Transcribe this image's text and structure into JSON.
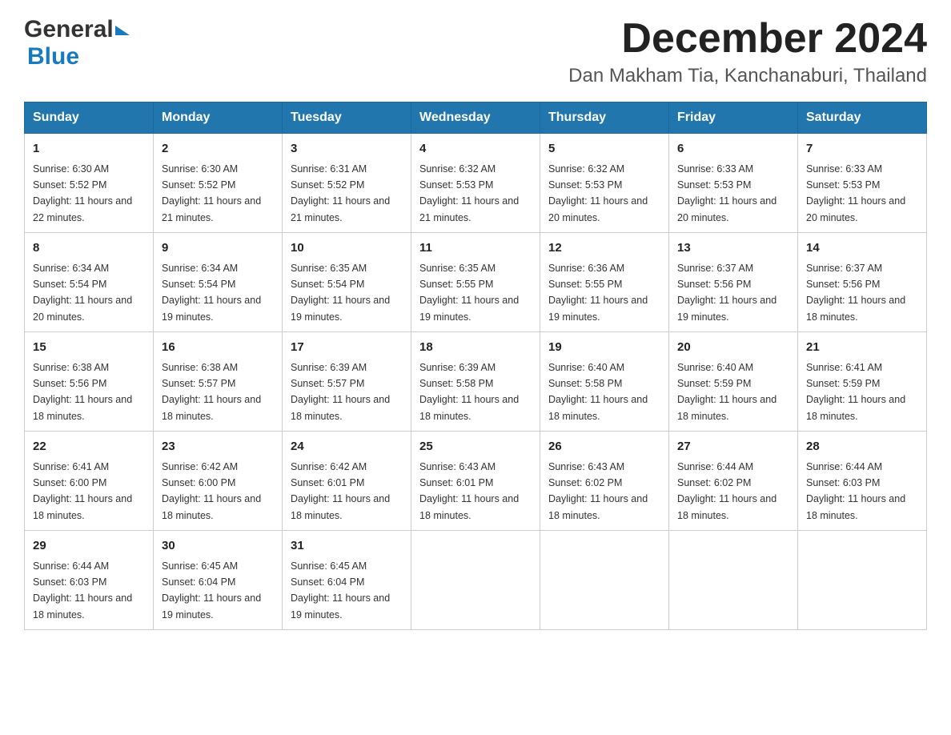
{
  "header": {
    "logo_general": "General",
    "logo_blue": "Blue",
    "month_title": "December 2024",
    "location": "Dan Makham Tia, Kanchanaburi, Thailand"
  },
  "weekdays": [
    "Sunday",
    "Monday",
    "Tuesday",
    "Wednesday",
    "Thursday",
    "Friday",
    "Saturday"
  ],
  "weeks": [
    [
      {
        "day": "1",
        "sunrise": "6:30 AM",
        "sunset": "5:52 PM",
        "daylight": "11 hours and 22 minutes."
      },
      {
        "day": "2",
        "sunrise": "6:30 AM",
        "sunset": "5:52 PM",
        "daylight": "11 hours and 21 minutes."
      },
      {
        "day": "3",
        "sunrise": "6:31 AM",
        "sunset": "5:52 PM",
        "daylight": "11 hours and 21 minutes."
      },
      {
        "day": "4",
        "sunrise": "6:32 AM",
        "sunset": "5:53 PM",
        "daylight": "11 hours and 21 minutes."
      },
      {
        "day": "5",
        "sunrise": "6:32 AM",
        "sunset": "5:53 PM",
        "daylight": "11 hours and 20 minutes."
      },
      {
        "day": "6",
        "sunrise": "6:33 AM",
        "sunset": "5:53 PM",
        "daylight": "11 hours and 20 minutes."
      },
      {
        "day": "7",
        "sunrise": "6:33 AM",
        "sunset": "5:53 PM",
        "daylight": "11 hours and 20 minutes."
      }
    ],
    [
      {
        "day": "8",
        "sunrise": "6:34 AM",
        "sunset": "5:54 PM",
        "daylight": "11 hours and 20 minutes."
      },
      {
        "day": "9",
        "sunrise": "6:34 AM",
        "sunset": "5:54 PM",
        "daylight": "11 hours and 19 minutes."
      },
      {
        "day": "10",
        "sunrise": "6:35 AM",
        "sunset": "5:54 PM",
        "daylight": "11 hours and 19 minutes."
      },
      {
        "day": "11",
        "sunrise": "6:35 AM",
        "sunset": "5:55 PM",
        "daylight": "11 hours and 19 minutes."
      },
      {
        "day": "12",
        "sunrise": "6:36 AM",
        "sunset": "5:55 PM",
        "daylight": "11 hours and 19 minutes."
      },
      {
        "day": "13",
        "sunrise": "6:37 AM",
        "sunset": "5:56 PM",
        "daylight": "11 hours and 19 minutes."
      },
      {
        "day": "14",
        "sunrise": "6:37 AM",
        "sunset": "5:56 PM",
        "daylight": "11 hours and 18 minutes."
      }
    ],
    [
      {
        "day": "15",
        "sunrise": "6:38 AM",
        "sunset": "5:56 PM",
        "daylight": "11 hours and 18 minutes."
      },
      {
        "day": "16",
        "sunrise": "6:38 AM",
        "sunset": "5:57 PM",
        "daylight": "11 hours and 18 minutes."
      },
      {
        "day": "17",
        "sunrise": "6:39 AM",
        "sunset": "5:57 PM",
        "daylight": "11 hours and 18 minutes."
      },
      {
        "day": "18",
        "sunrise": "6:39 AM",
        "sunset": "5:58 PM",
        "daylight": "11 hours and 18 minutes."
      },
      {
        "day": "19",
        "sunrise": "6:40 AM",
        "sunset": "5:58 PM",
        "daylight": "11 hours and 18 minutes."
      },
      {
        "day": "20",
        "sunrise": "6:40 AM",
        "sunset": "5:59 PM",
        "daylight": "11 hours and 18 minutes."
      },
      {
        "day": "21",
        "sunrise": "6:41 AM",
        "sunset": "5:59 PM",
        "daylight": "11 hours and 18 minutes."
      }
    ],
    [
      {
        "day": "22",
        "sunrise": "6:41 AM",
        "sunset": "6:00 PM",
        "daylight": "11 hours and 18 minutes."
      },
      {
        "day": "23",
        "sunrise": "6:42 AM",
        "sunset": "6:00 PM",
        "daylight": "11 hours and 18 minutes."
      },
      {
        "day": "24",
        "sunrise": "6:42 AM",
        "sunset": "6:01 PM",
        "daylight": "11 hours and 18 minutes."
      },
      {
        "day": "25",
        "sunrise": "6:43 AM",
        "sunset": "6:01 PM",
        "daylight": "11 hours and 18 minutes."
      },
      {
        "day": "26",
        "sunrise": "6:43 AM",
        "sunset": "6:02 PM",
        "daylight": "11 hours and 18 minutes."
      },
      {
        "day": "27",
        "sunrise": "6:44 AM",
        "sunset": "6:02 PM",
        "daylight": "11 hours and 18 minutes."
      },
      {
        "day": "28",
        "sunrise": "6:44 AM",
        "sunset": "6:03 PM",
        "daylight": "11 hours and 18 minutes."
      }
    ],
    [
      {
        "day": "29",
        "sunrise": "6:44 AM",
        "sunset": "6:03 PM",
        "daylight": "11 hours and 18 minutes."
      },
      {
        "day": "30",
        "sunrise": "6:45 AM",
        "sunset": "6:04 PM",
        "daylight": "11 hours and 19 minutes."
      },
      {
        "day": "31",
        "sunrise": "6:45 AM",
        "sunset": "6:04 PM",
        "daylight": "11 hours and 19 minutes."
      },
      null,
      null,
      null,
      null
    ]
  ]
}
